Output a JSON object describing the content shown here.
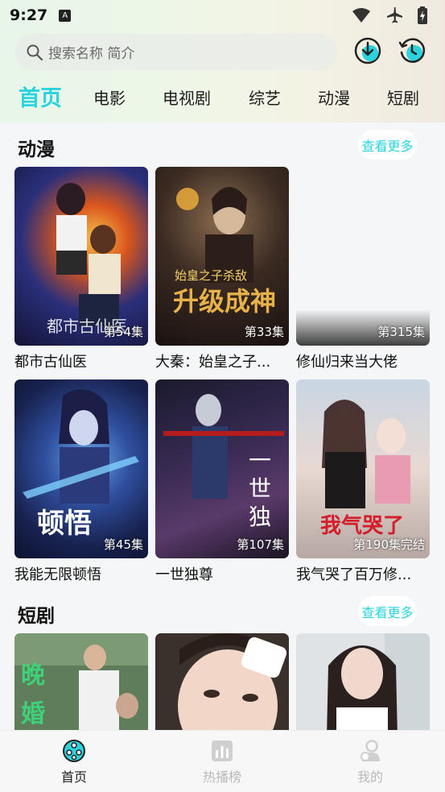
{
  "status_bar": {
    "time": "9:27",
    "notification_icon": "A"
  },
  "search": {
    "placeholder": "搜索名称 简介"
  },
  "tabs": [
    {
      "label": "首页",
      "active": true
    },
    {
      "label": "电影",
      "active": false
    },
    {
      "label": "电视剧",
      "active": false
    },
    {
      "label": "综艺",
      "active": false
    },
    {
      "label": "动漫",
      "active": false
    },
    {
      "label": "短剧",
      "active": false
    }
  ],
  "sections": {
    "anime": {
      "title": "动漫",
      "more_label": "查看更多",
      "items": [
        {
          "title": "都市古仙医",
          "episode": "第54集"
        },
        {
          "title": "大秦：始皇之子...",
          "episode": "第33集"
        },
        {
          "title": "修仙归来当大佬",
          "episode": "第315集"
        },
        {
          "title": "我能无限顿悟",
          "episode": "第45集"
        },
        {
          "title": "一世独尊",
          "episode": "第107集"
        },
        {
          "title": "我气哭了百万修...",
          "episode": "第190集完结"
        }
      ]
    },
    "short_drama": {
      "title": "短剧",
      "more_label": "查看更多"
    }
  },
  "bottom_nav": [
    {
      "label": "首页",
      "icon": "film-reel-icon",
      "active": true
    },
    {
      "label": "热播榜",
      "icon": "chart-icon",
      "active": false
    },
    {
      "label": "我的",
      "icon": "profile-icon",
      "active": false
    }
  ],
  "colors": {
    "accent": "#2ad3dd",
    "background": "#f5f6f7"
  }
}
